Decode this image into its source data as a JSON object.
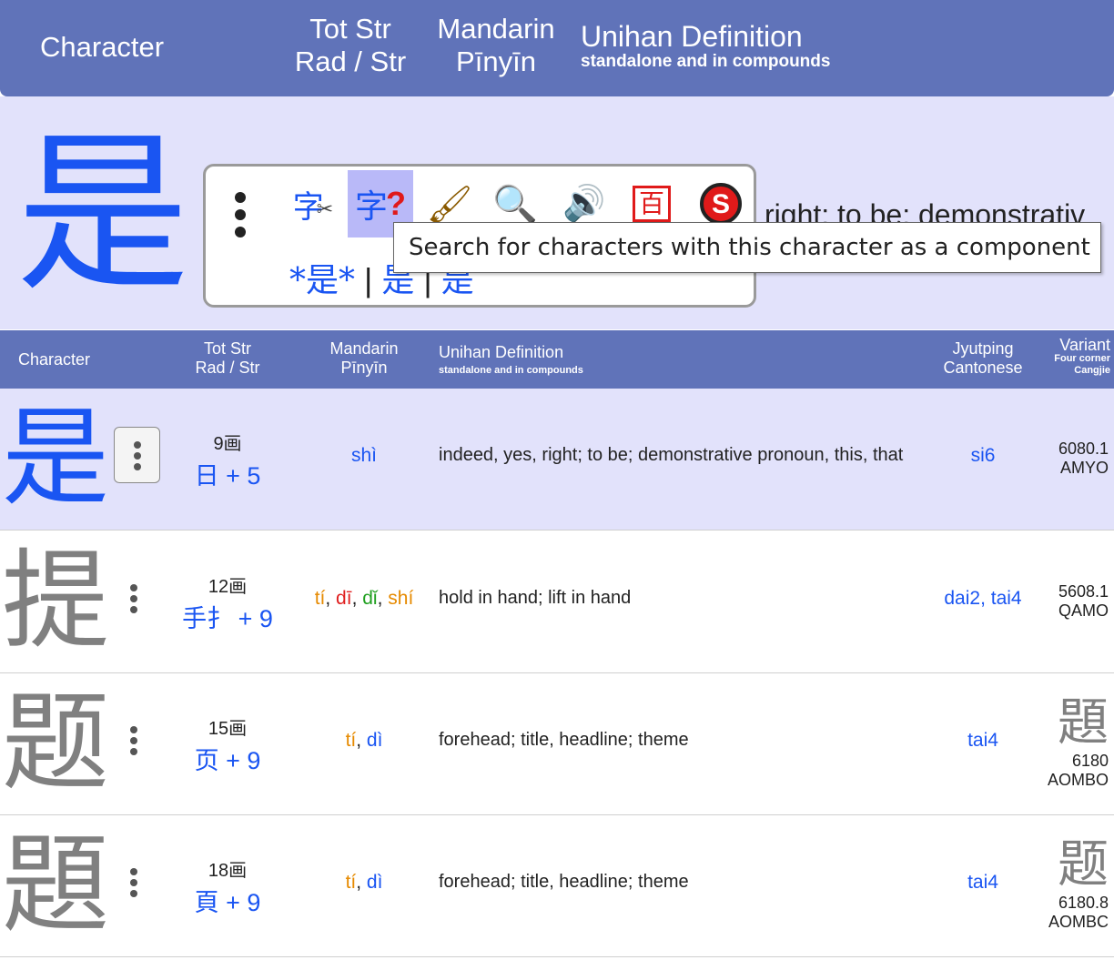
{
  "top_header": {
    "character": "Character",
    "tot_str": "Tot Str",
    "rad_str": "Rad / Str",
    "mandarin": "Mandarin",
    "pinyin": "Pīnyīn",
    "unihan": "Unihan Definition",
    "unihan_sub": "standalone and in compounds"
  },
  "zoom": {
    "character": "是",
    "definition_fragment": "right; to be; demonstrativ",
    "popup": {
      "tools": [
        "split-character-icon",
        "component-search-icon",
        "brush-stroke-icon",
        "magnifier-search-icon",
        "speaker-audio-icon",
        "baidu-bai-icon",
        "sogou-s-icon"
      ],
      "link_wildcard": "*是*",
      "link_2": "是",
      "link_3": "是",
      "separator": "|"
    },
    "tooltip": "Search for characters with this character as a component"
  },
  "table_header": {
    "character": "Character",
    "tot_str": "Tot Str",
    "rad_str": "Rad / Str",
    "mandarin": "Mandarin",
    "pinyin": "Pīnyīn",
    "unihan": "Unihan Definition",
    "unihan_sub": "standalone and in compounds",
    "jyutping": "Jyutping",
    "cantonese": "Cantonese",
    "variant": "Variant",
    "four_corner": "Four corner",
    "cangjie": "Cangjie"
  },
  "rows": [
    {
      "char": "是",
      "strokes": "9画",
      "radical": "日 + 5",
      "pinyin": [
        "shì"
      ],
      "definition": "indeed, yes, right; to be; demonstrative pronoun, this, that",
      "jyutping": "si6",
      "four_corner": "6080.1",
      "cangjie": "AMYO",
      "variant": ""
    },
    {
      "char": "提",
      "strokes": "12画",
      "radical": "手扌 + 9",
      "pinyin": [
        "tí",
        "dī",
        "dǐ",
        "shí"
      ],
      "definition": "hold in hand; lift in hand",
      "jyutping": "dai2, tai4",
      "four_corner": "5608.1",
      "cangjie": "QAMO",
      "variant": ""
    },
    {
      "char": "题",
      "strokes": "15画",
      "radical": "页 + 9",
      "pinyin": [
        "tí",
        "dì"
      ],
      "definition": "forehead; title, headline; theme",
      "jyutping": "tai4",
      "four_corner": "6180",
      "cangjie": "AOMBO",
      "variant": "題"
    },
    {
      "char": "題",
      "strokes": "18画",
      "radical": "頁 + 9",
      "pinyin": [
        "tí",
        "dì"
      ],
      "definition": "forehead; title, headline; theme",
      "jyutping": "tai4",
      "four_corner": "6180.8",
      "cangjie": "AOMBC",
      "variant": "题"
    }
  ],
  "colors": {
    "header_bg": "#6073b9",
    "highlight_bg": "#e2e2fb",
    "link_blue": "#1a55f2",
    "tone1_red": "#e02020",
    "tone2_orange": "#e68a00",
    "tone3_green": "#20a020",
    "tone4_blue": "#1a55f2"
  }
}
